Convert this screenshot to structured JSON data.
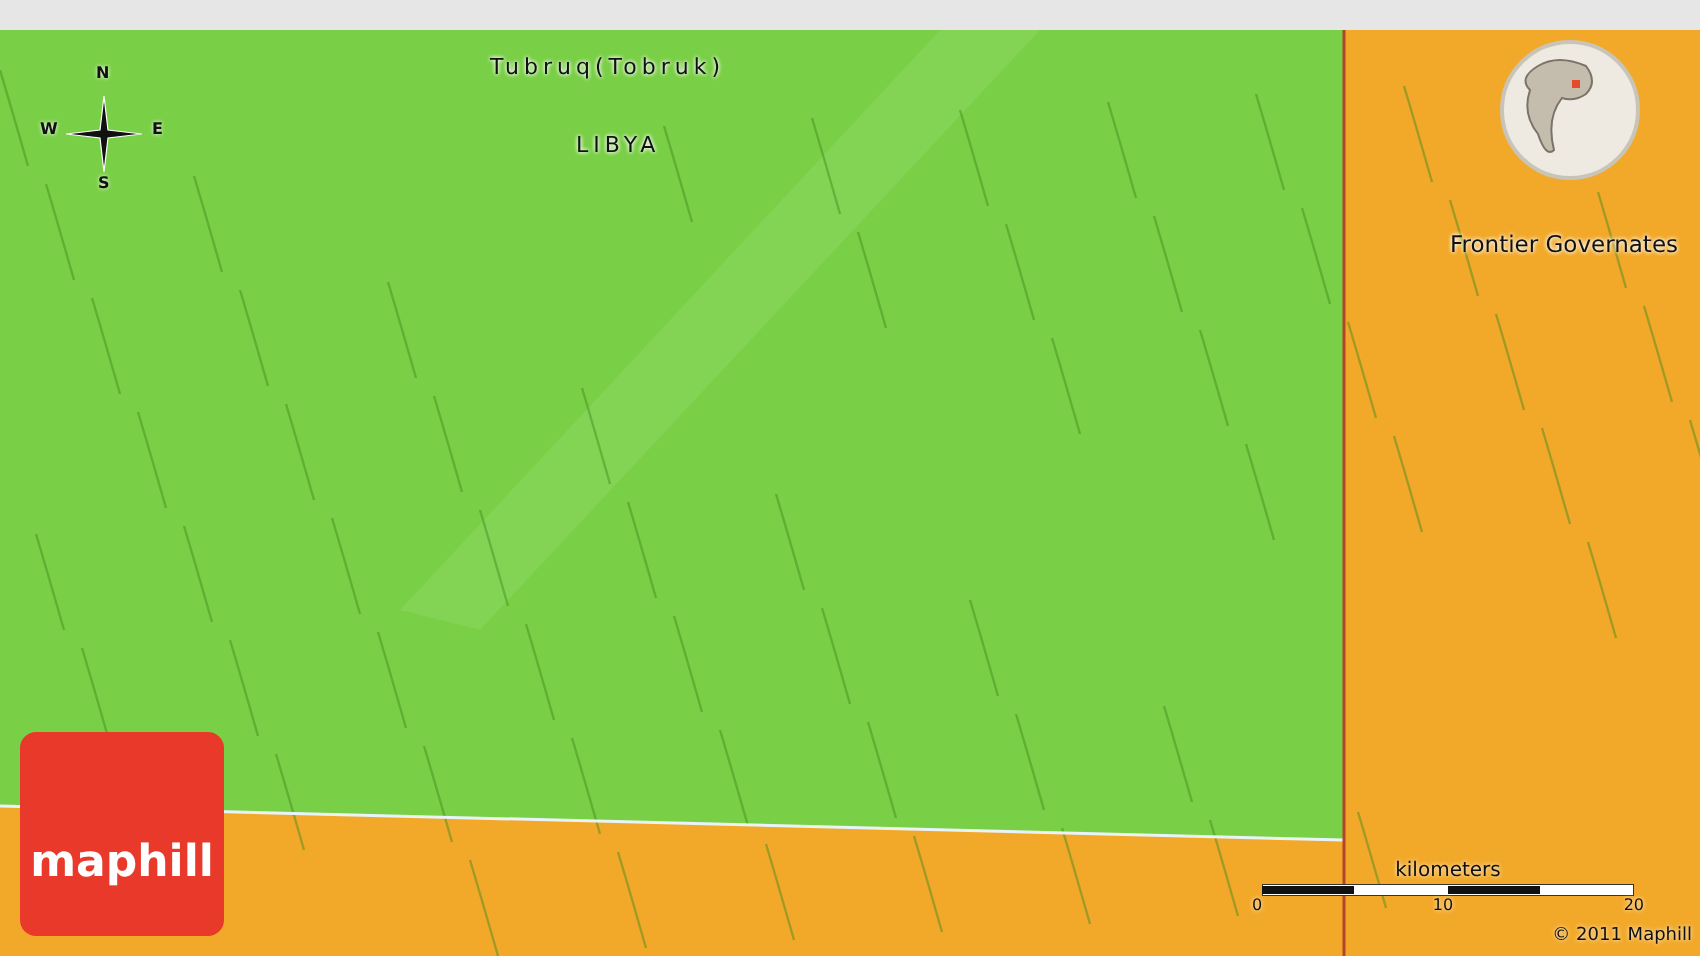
{
  "map": {
    "city_label": "Tubruq(Tobruk)",
    "country_label": "LIBYA",
    "region_label": "Frontier Governates"
  },
  "compass": {
    "north": "N",
    "east": "E",
    "south": "S",
    "west": "W"
  },
  "scale_bar": {
    "title": "kilometers",
    "ticks": [
      "0",
      "10",
      "20"
    ]
  },
  "copyright": "© 2011 Maphill",
  "logo": "maphill"
}
